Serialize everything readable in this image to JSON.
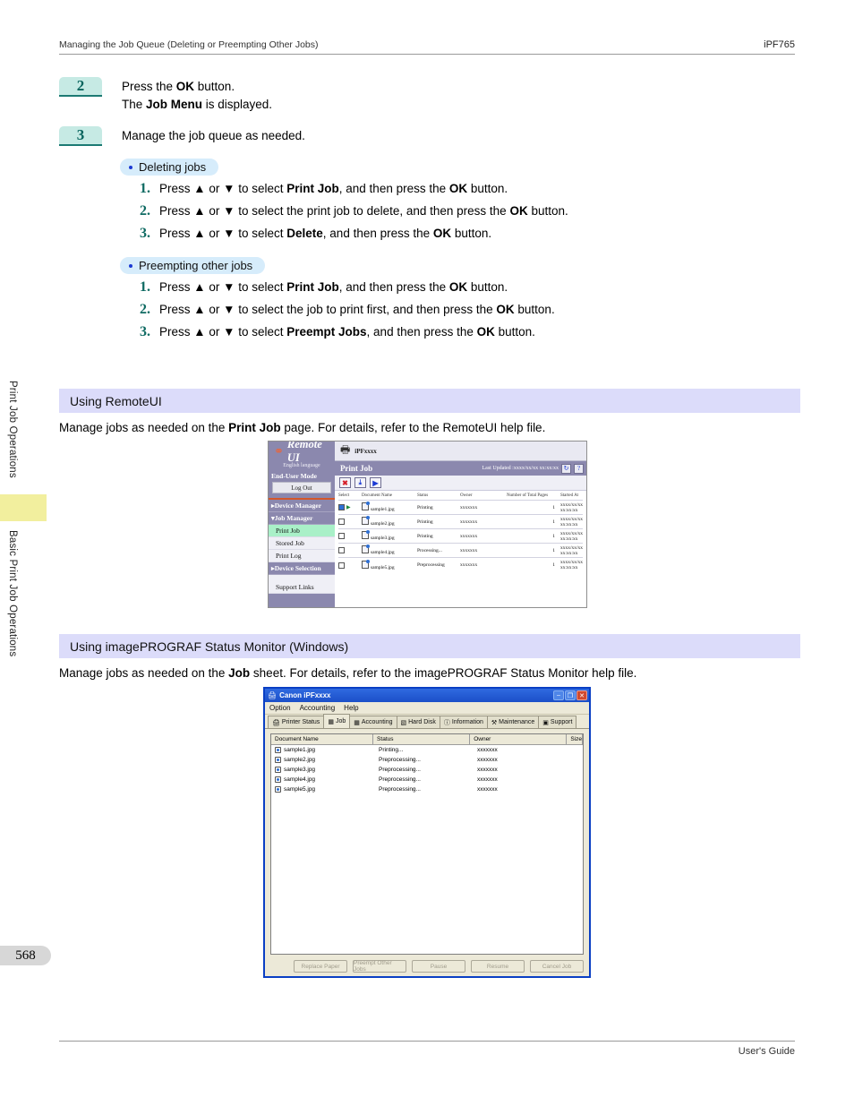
{
  "header": {
    "left": "Managing the Job Queue (Deleting or Preempting Other Jobs)",
    "right": "iPF765"
  },
  "footer": {
    "right": "User's Guide"
  },
  "side": {
    "tab_upper": "Print Job Operations",
    "tab_lower": "Basic Print Job Operations",
    "page_number": "568"
  },
  "steps": [
    {
      "num": "2",
      "line1_a": "Press the ",
      "line1_b": "OK",
      "line1_c": " button.",
      "line2_a": "The ",
      "line2_b": "Job Menu",
      "line2_c": " is displayed."
    },
    {
      "num": "3",
      "line1_a": "Manage the job queue as needed.",
      "line1_b": "",
      "line1_c": ""
    }
  ],
  "groups": [
    {
      "pill": "Deleting jobs",
      "items": [
        {
          "n": "1.",
          "a": "Press ▲ or ▼ to select ",
          "b": "Print Job",
          "c": ", and then press the ",
          "d": "OK",
          "e": " button."
        },
        {
          "n": "2.",
          "a": "Press ▲ or ▼ to select the print job to delete, and then press the ",
          "b": "",
          "c": "",
          "d": "OK",
          "e": " button."
        },
        {
          "n": "3.",
          "a": "Press ▲ or ▼ to select ",
          "b": "Delete",
          "c": ", and then press the ",
          "d": "OK",
          "e": " button."
        }
      ]
    },
    {
      "pill": "Preempting other jobs",
      "items": [
        {
          "n": "1.",
          "a": "Press ▲ or ▼ to select ",
          "b": "Print Job",
          "c": ", and then press the ",
          "d": "OK",
          "e": " button."
        },
        {
          "n": "2.",
          "a": "Press ▲ or ▼ to select the job to print first, and then press the ",
          "b": "",
          "c": "",
          "d": "OK",
          "e": " button."
        },
        {
          "n": "3.",
          "a": "Press ▲ or ▼ to select ",
          "b": "Preempt Jobs",
          "c": ", and then press the ",
          "d": "OK",
          "e": " button."
        }
      ]
    }
  ],
  "section_remoteui": {
    "heading": "Using RemoteUI",
    "desc_a": "Manage jobs as needed on the ",
    "desc_b": "Print Job",
    "desc_c": " page. For details, refer to the RemoteUI help file."
  },
  "section_statusmonitor": {
    "heading": "Using imagePROGRAF Status Monitor (Windows)",
    "desc_a": "Manage jobs as needed on the ",
    "desc_b": "Job",
    "desc_c": " sheet. For details, refer to the imagePROGRAF Status Monitor help file."
  },
  "remoteui": {
    "logo": "Remote UI",
    "language": "English language",
    "mode": "End-User Mode",
    "logout": "Log Out",
    "nav": [
      {
        "label": "Device Manager",
        "type": "group",
        "marker": "▸"
      },
      {
        "label": "Job Manager",
        "type": "group",
        "marker": "▾"
      },
      {
        "label": "Print Job",
        "type": "item",
        "selected": true
      },
      {
        "label": "Stored Job",
        "type": "item",
        "selected": false
      },
      {
        "label": "Print Log",
        "type": "item",
        "selected": false
      },
      {
        "label": "Device Selection",
        "type": "group",
        "marker": "▸"
      },
      {
        "label": "Support Links",
        "type": "item",
        "selected": false
      }
    ],
    "model": "iPFxxxx",
    "page_title": "Print Job",
    "last_updated": "Last Updated :xxxx/xx/xx xx:xx:xx",
    "refresh_icon": "↻",
    "help_icon": "?",
    "toolbar": [
      {
        "name": "delete",
        "glyph": "✖"
      },
      {
        "name": "move-to-bottom",
        "glyph": "⤓"
      },
      {
        "name": "start",
        "glyph": "▶"
      }
    ],
    "columns": [
      "Select",
      "Document Name",
      "Status",
      "Owner",
      "Number of Total Pages",
      "Started At"
    ],
    "rows": [
      {
        "checked": true,
        "doc": "sample1.jpg",
        "status": "Printing",
        "owner": "xxxxxxx",
        "pages": "1",
        "started": "xxxx/xx/xx xx:xx:xx"
      },
      {
        "checked": false,
        "doc": "sample2.jpg",
        "status": "Printing",
        "owner": "xxxxxxx",
        "pages": "1",
        "started": "xxxx/xx/xx xx:xx:xx"
      },
      {
        "checked": false,
        "doc": "sample3.jpg",
        "status": "Printing",
        "owner": "xxxxxxx",
        "pages": "1",
        "started": "xxxx/xx/xx xx:xx:xx"
      },
      {
        "checked": false,
        "doc": "sample4.jpg",
        "status": "Processing...",
        "owner": "xxxxxxx",
        "pages": "1",
        "started": "xxxx/xx/xx xx:xx:xx"
      },
      {
        "checked": false,
        "doc": "sample5.jpg",
        "status": "Preprocessing",
        "owner": "xxxxxxx",
        "pages": "1",
        "started": "xxxx/xx/xx xx:xx:xx"
      }
    ]
  },
  "statusmonitor": {
    "title": "Canon iPFxxxx",
    "window_buttons": [
      "–",
      "❐",
      "✕"
    ],
    "menus": [
      "Option",
      "Accounting",
      "Help"
    ],
    "tabs": [
      {
        "label": "Printer Status",
        "icon": "⚙",
        "active": false
      },
      {
        "label": "Job",
        "icon": "▤",
        "active": true
      },
      {
        "label": "Accounting",
        "icon": "▦",
        "active": false
      },
      {
        "label": "Hard Disk",
        "icon": "▧",
        "active": false
      },
      {
        "label": "Information",
        "icon": "ⓘ",
        "active": false
      },
      {
        "label": "Maintenance",
        "icon": "⚒",
        "active": false
      },
      {
        "label": "Support",
        "icon": "⊕",
        "active": false
      }
    ],
    "columns": [
      "Document Name",
      "Status",
      "Owner",
      "Size"
    ],
    "rows": [
      {
        "doc": "sample1.jpg",
        "status": "Printing...",
        "owner": "xxxxxxx",
        "size": ""
      },
      {
        "doc": "sample2.jpg",
        "status": "Preprocessing...",
        "owner": "xxxxxxx",
        "size": ""
      },
      {
        "doc": "sample3.jpg",
        "status": "Preprocessing...",
        "owner": "xxxxxxx",
        "size": ""
      },
      {
        "doc": "sample4.jpg",
        "status": "Preprocessing...",
        "owner": "xxxxxxx",
        "size": ""
      },
      {
        "doc": "sample5.jpg",
        "status": "Preprocessing...",
        "owner": "xxxxxxx",
        "size": ""
      }
    ],
    "buttons": [
      "Replace Paper",
      "Preempt Other Jobs",
      "Pause",
      "Resume",
      "Cancel Job"
    ]
  }
}
